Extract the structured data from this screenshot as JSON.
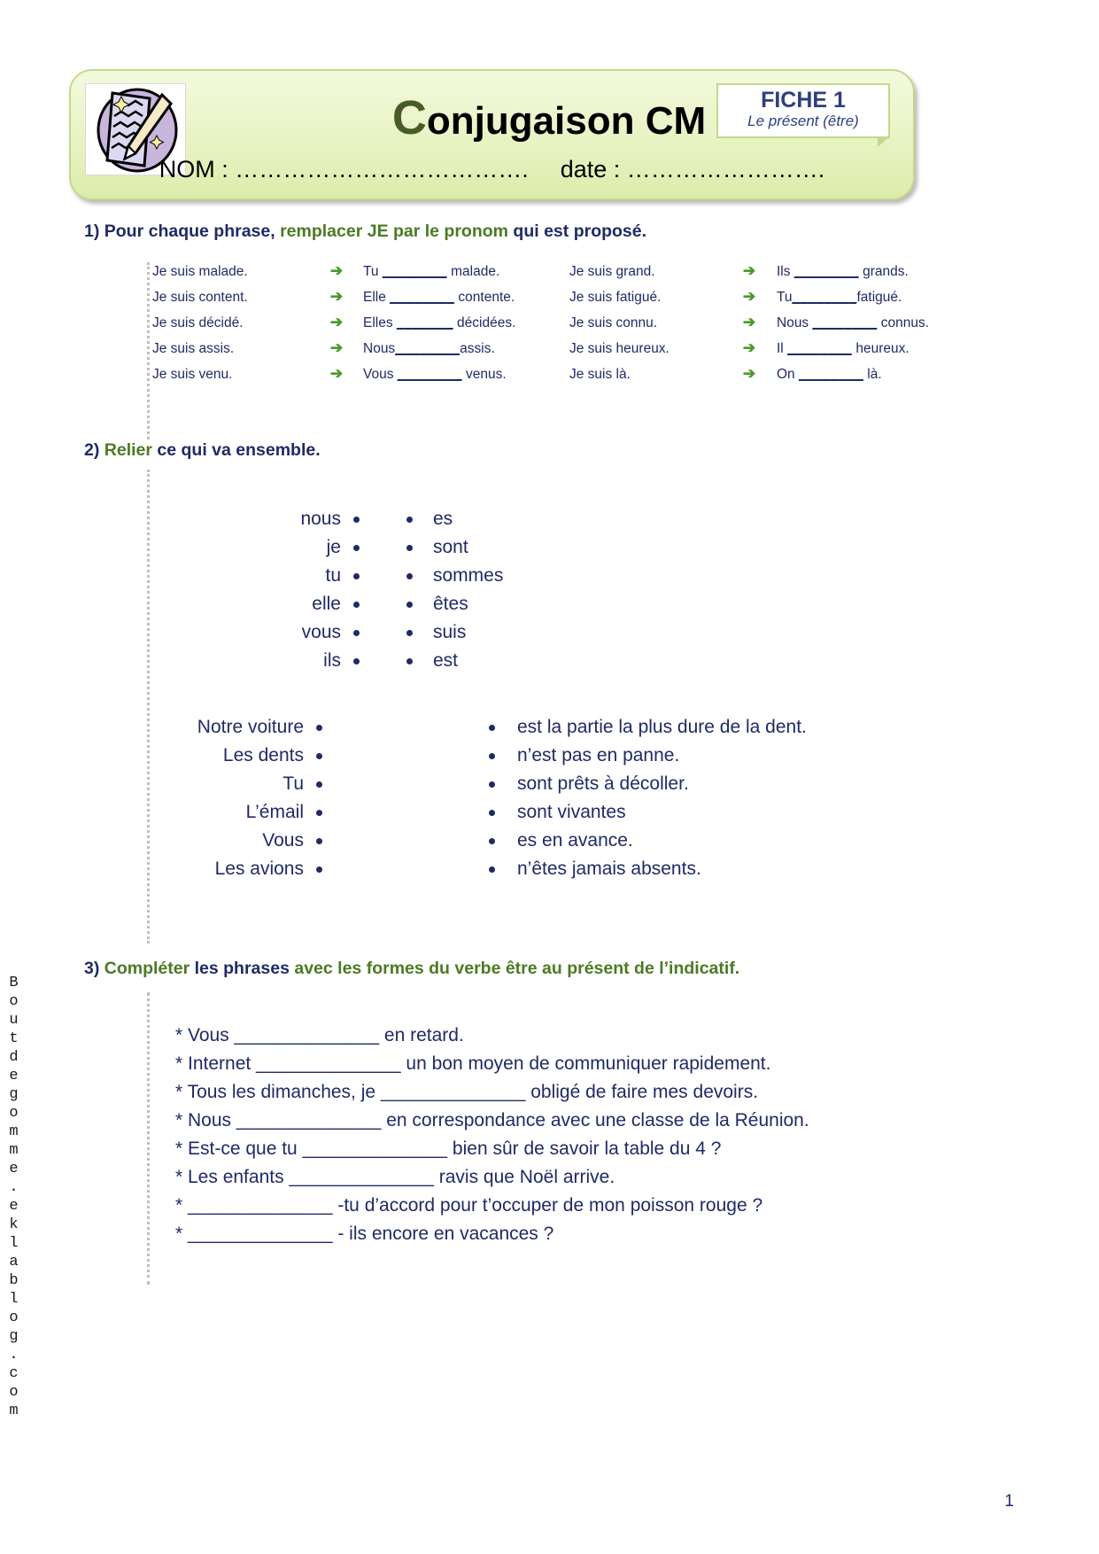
{
  "watermark": "Boutdegomme.eklablog.com",
  "header": {
    "title_first_letter": "C",
    "title_rest": "onjugaison CM",
    "fiche_label": "FICHE 1",
    "fiche_sub": "Le présent (être)",
    "nom_label": "NOM : ……………………………….",
    "date_label": "date : …………………….",
    "logo_icon": "notebook-pencil-icon"
  },
  "exercise1": {
    "heading": {
      "number": "1)",
      "part1": " Pour chaque phrase, ",
      "part2": "remplacer JE par le pronom",
      "part3": " qui est proposé."
    },
    "arrow": "➔",
    "rows": [
      {
        "left": "Je suis malade.",
        "right_pre": "Tu ",
        "right_blank": "________",
        "right_post": " malade.",
        "left2": "Je suis grand.",
        "right2_pre": "Ils ",
        "right2_blank": "________",
        "right2_post": " grands."
      },
      {
        "left": "Je suis content.",
        "right_pre": "Elle ",
        "right_blank": "________",
        "right_post": " contente.",
        "left2": "Je suis fatigué.",
        "right2_pre": "Tu",
        "right2_blank": "________",
        "right2_post": "fatigué."
      },
      {
        "left": "Je suis décidé.",
        "right_pre": "Elles ",
        "right_blank": "_______",
        "right_post": " décidées.",
        "left2": "Je suis connu.",
        "right2_pre": "Nous ",
        "right2_blank": "________",
        "right2_post": " connus."
      },
      {
        "left": "Je suis assis.",
        "right_pre": "Nous",
        "right_blank": "________",
        "right_post": "assis.",
        "left2": "Je suis heureux.",
        "right2_pre": "Il ",
        "right2_blank": "________",
        "right2_post": " heureux."
      },
      {
        "left": "Je suis venu.",
        "right_pre": "Vous ",
        "right_blank": "________",
        "right_post": " venus.",
        "left2": "Je suis là.",
        "right2_pre": "On ",
        "right2_blank": "________",
        "right2_post": " là."
      }
    ]
  },
  "exercise2": {
    "heading": {
      "number": "2)",
      "part1": " ",
      "part2": "Relier",
      "part3": " ce qui va ensemble."
    },
    "pronouns_left": [
      "nous",
      "je",
      "tu",
      "elle",
      "vous",
      "ils"
    ],
    "pronouns_right": [
      "es",
      "sont",
      "sommes",
      "êtes",
      "suis",
      "est"
    ],
    "subjects_left": [
      "Notre voiture",
      "Les dents",
      "Tu",
      "L’émail",
      "Vous",
      "Les avions"
    ],
    "subjects_right": [
      "est la partie la plus dure de la dent.",
      "n’est pas en panne.",
      "sont prêts à décoller.",
      "sont vivantes",
      "es en avance.",
      "n’êtes jamais absents."
    ]
  },
  "exercise3": {
    "heading": {
      "number": "3)",
      "part1": " ",
      "part2": "Compléter",
      "part3": " ",
      "part4": "les phrases",
      "part5": " avec les formes du verbe être au présent de l’indicatif."
    },
    "sentences": [
      "* Vous ______________ en retard.",
      "* Internet ______________ un bon moyen de communiquer rapidement.",
      "* Tous les dimanches, je ______________ obligé de faire mes devoirs.",
      "* Nous ______________ en correspondance avec une classe de la Réunion.",
      "* Est-ce que tu ______________ bien sûr de savoir la table du 4 ?",
      "* Les enfants ______________ ravis que Noël arrive.",
      "* ______________  -tu d’accord pour t’occuper de mon poisson rouge ?",
      "* ______________ - ils encore en vacances ?"
    ]
  },
  "footer": {
    "page_number": "1"
  }
}
